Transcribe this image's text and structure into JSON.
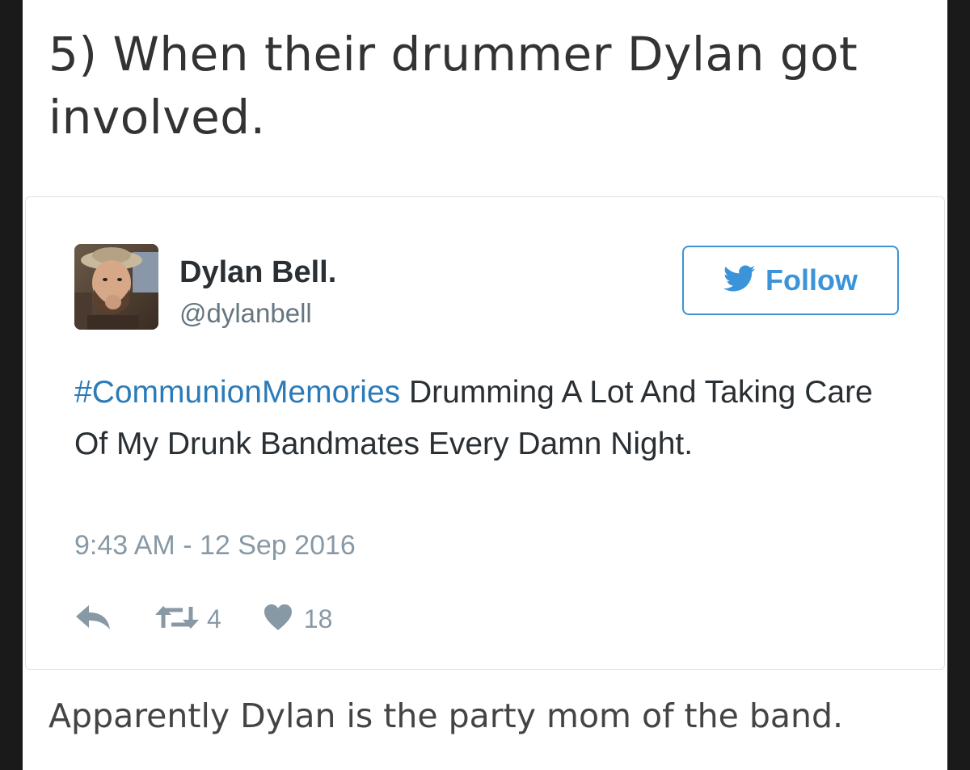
{
  "article": {
    "heading": "5) When their drummer Dylan got involved.",
    "caption": "Apparently Dylan is the party mom of the band."
  },
  "tweet": {
    "author": {
      "display_name": "Dylan Bell.",
      "handle": "@dylanbell",
      "avatar_icon": "profile-photo"
    },
    "follow_button": {
      "label": "Follow",
      "icon": "twitter-bird-icon",
      "color": "#3b94d9"
    },
    "hashtag": "#CommunionMemories",
    "body": " Drumming A Lot And Taking Care Of My Drunk Bandmates Every Damn Night.",
    "timestamp": "9:43 AM - 12 Sep 2016",
    "actions": {
      "reply_icon": "reply-icon",
      "retweet_icon": "retweet-icon",
      "retweet_count": "4",
      "like_icon": "heart-icon",
      "like_count": "18"
    },
    "colors": {
      "link": "#2b7bb9",
      "muted": "#8899a6",
      "text": "#292f33"
    }
  }
}
